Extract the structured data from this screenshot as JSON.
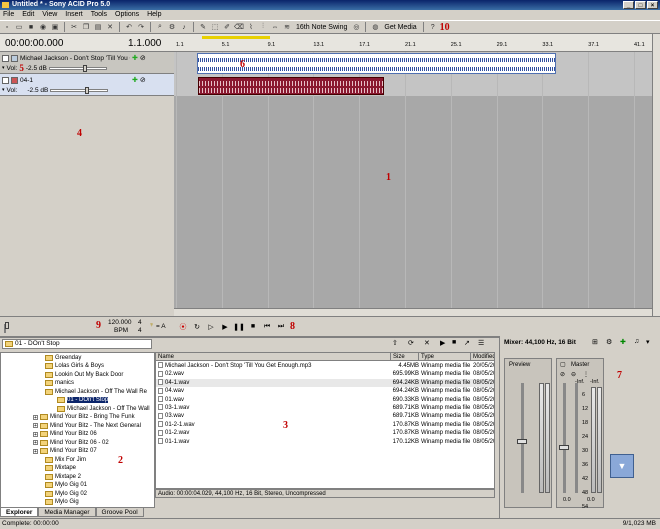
{
  "window": {
    "title": "Untitled * - Sony ACID Pro 5.0"
  },
  "menu": [
    "File",
    "Edit",
    "View",
    "Insert",
    "Tools",
    "Options",
    "Help"
  ],
  "toolbar": {
    "swing": "16th Note Swing",
    "get_media": "Get Media"
  },
  "time": {
    "position": "00:00:00.000",
    "measure": "1.1.000"
  },
  "ruler_ticks": [
    "1.1",
    "5.1",
    "9.1",
    "13.1",
    "17.1",
    "21.1",
    "25.1",
    "29.1",
    "33.1",
    "37.1",
    "41.1"
  ],
  "tracks": [
    {
      "name": "Michael Jackson - Don't Stop 'Till You Get Enough",
      "vol_label": "Vol:",
      "vol": "-2.5 dB",
      "vol_pct": 0.6
    },
    {
      "name": "04-1",
      "vol_label": "Vol:",
      "vol": "-2.5 dB",
      "vol_pct": 0.6
    }
  ],
  "tempo": {
    "bpm": "120.000",
    "bpm_label": "BPM",
    "sig_top": "4",
    "sig_bottom": "4",
    "key": "= A"
  },
  "explorer": {
    "path": "01 - DOn't Stop",
    "tree": [
      "Greenday",
      "Lolas Girls & Boys",
      "Lookin Out My Back Door",
      "manics",
      "Michael Jackson - Off The Wall Re",
      "01 - DOn't Stop",
      "Michael Jackson - Off The Wall",
      "Mind Your Bitz - Bring The Funk",
      "Mind Your Bitz - The Next General",
      "Mind Your Bitz 06",
      "Mind Your Bitz 06 - 02",
      "Mind Your Bitz 07",
      "Mix For Jim",
      "Mixtape",
      "Mixtape 2",
      "Mylo Gig 01",
      "Mylo Gig 02",
      "Mylo Gig"
    ],
    "columns": {
      "name": "Name",
      "size": "Size",
      "type": "Type",
      "modified": "Modified"
    },
    "files": [
      {
        "name": "Michael Jackson - Don't Stop 'Till You Get Enough.mp3",
        "size": "4.45MB",
        "type": "Winamp media file",
        "modified": "20/05/2004 15:21"
      },
      {
        "name": "02.wav",
        "size": "695.99KB",
        "type": "Winamp media file",
        "modified": "08/05/2006 16:02"
      },
      {
        "name": "04-1.wav",
        "size": "694.24KB",
        "type": "Winamp media file",
        "modified": "08/05/2006 16:04"
      },
      {
        "name": "04.wav",
        "size": "694.24KB",
        "type": "Winamp media file",
        "modified": "08/05/2006 16:03"
      },
      {
        "name": "01.wav",
        "size": "690.33KB",
        "type": "Winamp media file",
        "modified": "08/05/2006 15:59"
      },
      {
        "name": "03-1.wav",
        "size": "689.71KB",
        "type": "Winamp media file",
        "modified": "08/05/2006 16:03"
      },
      {
        "name": "03.wav",
        "size": "689.71KB",
        "type": "Winamp media file",
        "modified": "08/05/2006 16:02"
      },
      {
        "name": "01-2-1.wav",
        "size": "170.87KB",
        "type": "Winamp media file",
        "modified": "08/05/2006 16:01"
      },
      {
        "name": "01-2.wav",
        "size": "170.87KB",
        "type": "Winamp media file",
        "modified": "08/05/2006 16:01"
      },
      {
        "name": "01-1.wav",
        "size": "170.12KB",
        "type": "Winamp media file",
        "modified": "08/05/2006 16:00"
      }
    ],
    "audio_info": "Audio: 00:00:04.029, 44,100 Hz, 16 Bit, Stereo, Uncompressed"
  },
  "tabs": [
    "Explorer",
    "Media Manager",
    "Groove Pool"
  ],
  "mixer": {
    "title": "Mixer: 44,100 Hz, 16 Bit",
    "preview": "Preview",
    "master": "Master",
    "db_top": "-Inf.",
    "db_scale": [
      "6",
      "12",
      "18",
      "24",
      "30",
      "36",
      "42",
      "48",
      "54"
    ],
    "val_left": "0.0",
    "val_right": "0.0"
  },
  "status": {
    "left": "Complete: 00:00:00",
    "right": "9/1,023 MB"
  },
  "annotations": [
    "1",
    "2",
    "3",
    "4",
    "5",
    "6",
    "7",
    "8",
    "9",
    "10"
  ]
}
